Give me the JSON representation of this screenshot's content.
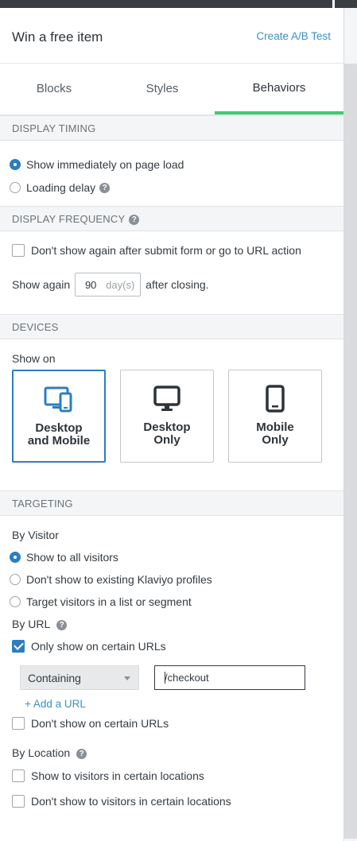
{
  "header": {
    "title": "Win a free item",
    "ab_test_link": "Create A/B Test"
  },
  "tabs": [
    {
      "label": "Blocks",
      "active": false
    },
    {
      "label": "Styles",
      "active": false
    },
    {
      "label": "Behaviors",
      "active": true
    }
  ],
  "display_timing": {
    "heading": "DISPLAY TIMING",
    "options": [
      {
        "label": "Show immediately on page load",
        "selected": true
      },
      {
        "label": "Loading delay",
        "selected": false
      }
    ]
  },
  "display_frequency": {
    "heading": "DISPLAY FREQUENCY",
    "dont_show_again_label": "Don't show again after submit form or go to URL action",
    "show_again_prefix": "Show again",
    "show_again_days": "90",
    "show_again_unit": "day(s)",
    "show_again_suffix": "after closing."
  },
  "devices": {
    "heading": "DEVICES",
    "show_on_label": "Show on",
    "options": [
      {
        "label": "Desktop\nand Mobile",
        "icon": "desktop-and-mobile-icon",
        "selected": true
      },
      {
        "label": "Desktop\nOnly",
        "icon": "desktop-icon",
        "selected": false
      },
      {
        "label": "Mobile\nOnly",
        "icon": "mobile-icon",
        "selected": false
      }
    ]
  },
  "targeting": {
    "heading": "TARGETING",
    "by_visitor_label": "By Visitor",
    "visitor_options": [
      {
        "label": "Show to all visitors",
        "selected": true
      },
      {
        "label": "Don't show to existing Klaviyo profiles",
        "selected": false
      },
      {
        "label": "Target visitors in a list or segment",
        "selected": false
      }
    ],
    "by_url_label": "By URL",
    "only_show_urls_label": "Only show on certain URLs",
    "only_show_urls_checked": true,
    "url_match_type": "Containing",
    "url_value": "/checkout",
    "add_url_label": "+ Add a URL",
    "dont_show_urls_label": "Don't show on certain URLs",
    "by_location_label": "By Location",
    "location_show_label": "Show to visitors in certain locations",
    "location_dont_show_label": "Don't show to visitors in certain locations"
  },
  "colors": {
    "accent": "#2d7dc0",
    "link": "#3c8fc7",
    "active_tab": "#3fca73"
  }
}
